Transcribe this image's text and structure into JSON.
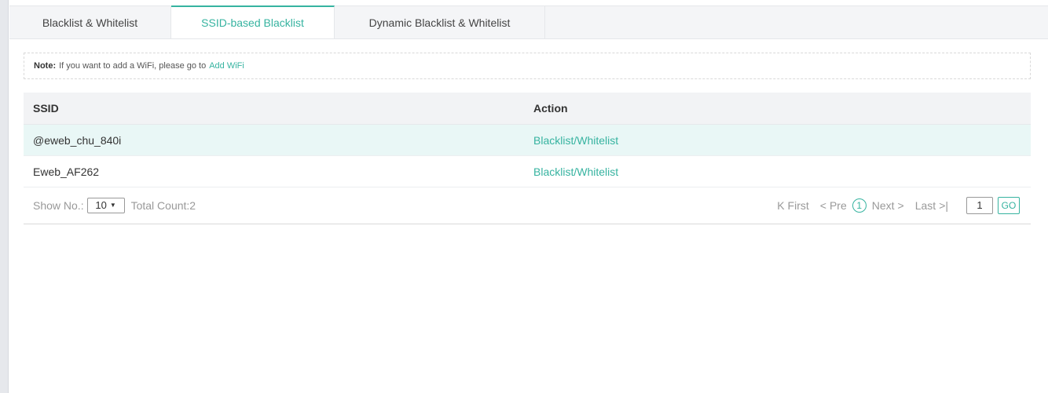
{
  "tabs": [
    {
      "label": "Blacklist & Whitelist",
      "active": false
    },
    {
      "label": "SSID-based Blacklist",
      "active": true
    },
    {
      "label": "Dynamic Blacklist & Whitelist",
      "active": false
    }
  ],
  "note": {
    "label": "Note:",
    "text": "If you want to add a WiFi, please go to",
    "link": "Add WiFi"
  },
  "table": {
    "headers": [
      "SSID",
      "Action"
    ],
    "rows": [
      {
        "ssid": "@eweb_chu_840i",
        "action": "Blacklist/Whitelist"
      },
      {
        "ssid": "Eweb_AF262",
        "action": "Blacklist/Whitelist"
      }
    ]
  },
  "footer": {
    "show_no_label": "Show No.:",
    "page_size": "10",
    "total_count": "Total Count:2"
  },
  "pager": {
    "first": "First",
    "pre": "Pre",
    "current": "1",
    "next": "Next",
    "last": "Last",
    "page_input": "1",
    "go": "GO"
  },
  "colors": {
    "accent": "#36b3a0",
    "row_highlight": "#e9f7f6"
  }
}
